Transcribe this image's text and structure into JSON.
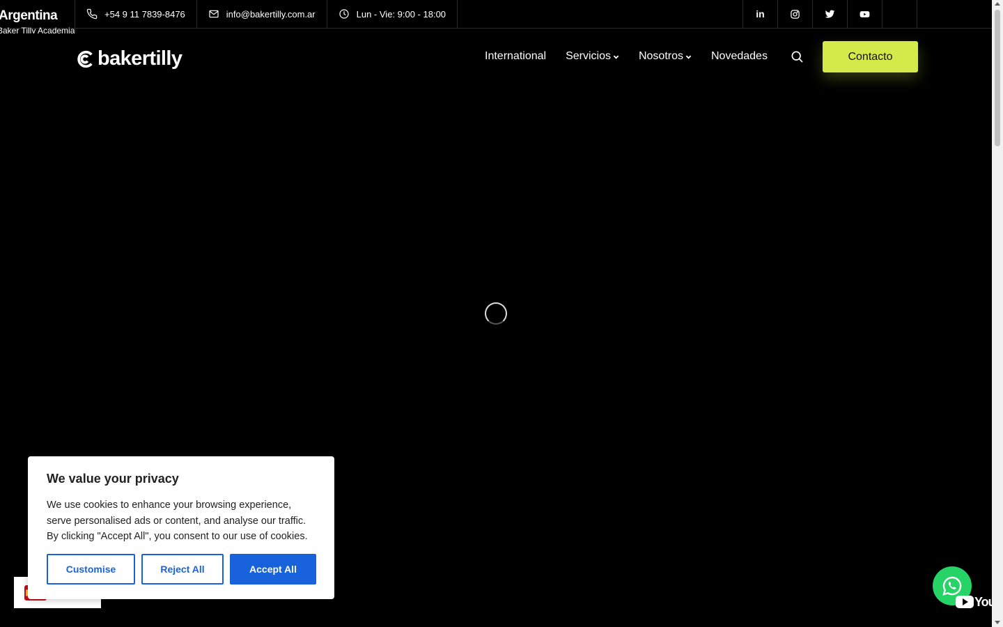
{
  "topbar": {
    "country": "Argentina",
    "academia": "Baker Tilly Academia",
    "phone": "+54 9 11 7839-8476",
    "email": "info@bakertilly.com.ar",
    "hours": "Lun - Vie: 9:00 - 18:00",
    "socials": [
      {
        "label": "in",
        "icon": "linkedin-icon"
      },
      {
        "icon": "instagram-icon"
      },
      {
        "icon": "twitter-icon"
      },
      {
        "icon": "youtube-icon"
      },
      {
        "label": "",
        "icon": "tiktok-icon"
      }
    ]
  },
  "header": {
    "logo_text": "bakertilly",
    "nav": [
      "International",
      "Servicios",
      "Nosotros",
      "Novedades"
    ],
    "contact_button": "Contacto"
  },
  "cookie": {
    "title": "We value your privacy",
    "body": "We use cookies to enhance your browsing experience, serve personalised ads or content, and analyse our traffic. By clicking \"Accept All\", you consent to our use of cookies.",
    "customise": "Customise",
    "reject": "Reject All",
    "accept": "Accept All"
  },
  "youtube_badge": "YouTube",
  "colors": {
    "background": "#000000",
    "accent": "#d4ea4a",
    "cookie_button": "#1863dc",
    "whatsapp": "#25d366"
  }
}
